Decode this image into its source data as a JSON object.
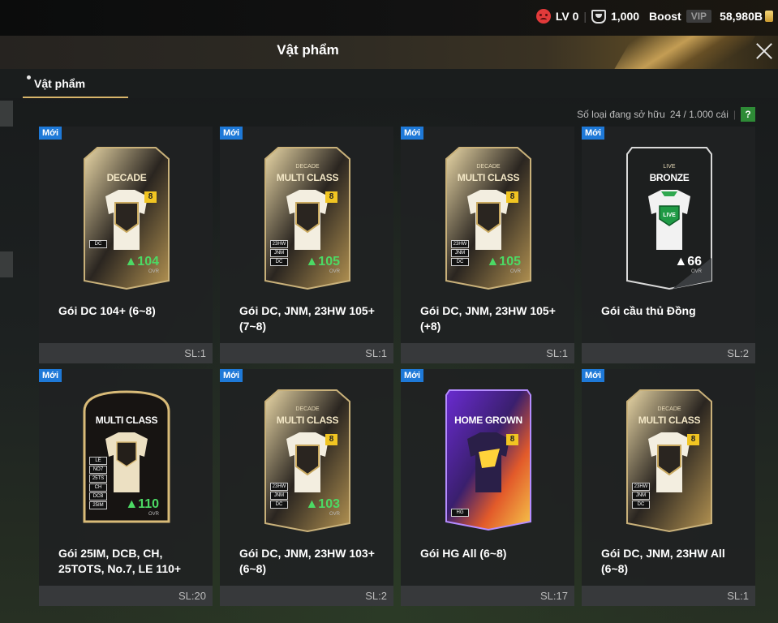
{
  "status": {
    "level": "LV 0",
    "trophies": "1,000",
    "boost": "Boost",
    "vip": "VIP",
    "currency": "58,980B"
  },
  "header": {
    "title": "Vật phẩm"
  },
  "tabs": [
    {
      "label": "Vật phẩm"
    }
  ],
  "summary": {
    "label": "Số loại đang sở hữu",
    "value": "24 / 1.000 cái",
    "help": "?"
  },
  "items": [
    {
      "badge": "Mới",
      "card_title": "DECADE",
      "card_sub": "",
      "ovr": "104",
      "name": "Gói DC 104+ (6~8)",
      "qty": "SL:1"
    },
    {
      "badge": "Mới",
      "card_title": "MULTI CLASS",
      "card_sub": "DECADE",
      "ovr": "105",
      "name": "Gói DC, JNM, 23HW 105+ (7~8)",
      "qty": "SL:1"
    },
    {
      "badge": "Mới",
      "card_title": "MULTI CLASS",
      "card_sub": "DECADE",
      "ovr": "105",
      "name": "Gói DC, JNM, 23HW 105+ (+8)",
      "qty": "SL:1"
    },
    {
      "badge": "Mới",
      "card_title": "BRONZE",
      "card_sub": "LIVE",
      "ovr": "66",
      "name": "Gói cầu thủ Đồng",
      "qty": "SL:2"
    },
    {
      "badge": "Mới",
      "card_title": "MULTI CLASS",
      "card_sub": "",
      "ovr": "110",
      "name": "Gói 25IM, DCB, CH, 25TOTS, No.7, LE 110+",
      "qty": "SL:20"
    },
    {
      "badge": "Mới",
      "card_title": "MULTI CLASS",
      "card_sub": "DECADE",
      "ovr": "103",
      "name": "Gói DC, JNM, 23HW 103+ (6~8)",
      "qty": "SL:2"
    },
    {
      "badge": "Mới",
      "card_title": "HOME GROWN",
      "card_sub": "",
      "ovr": "",
      "name": "Gói HG All (6~8)",
      "qty": "SL:17"
    },
    {
      "badge": "Mới",
      "card_title": "MULTI CLASS",
      "card_sub": "DECADE",
      "ovr": "",
      "name": "Gói DC, JNM, 23HW All (6~8)",
      "qty": "SL:1"
    }
  ],
  "card_labels": {
    "ovr": "OVR",
    "eight": "8",
    "live": "LIVE",
    "dc": "DC",
    "jnm": "JNM",
    "hw": "23HW",
    "hg": "HG",
    "le": "LE",
    "no7": "NO7",
    "tots": "25TS",
    "ch": "CH",
    "dcb": "DCB",
    "im": "25IM"
  },
  "colors": {
    "accent_gold": "#d8b56a",
    "new_badge": "#1e79d8",
    "ovr_green": "#4cd964",
    "help_green": "#2e8b36"
  }
}
